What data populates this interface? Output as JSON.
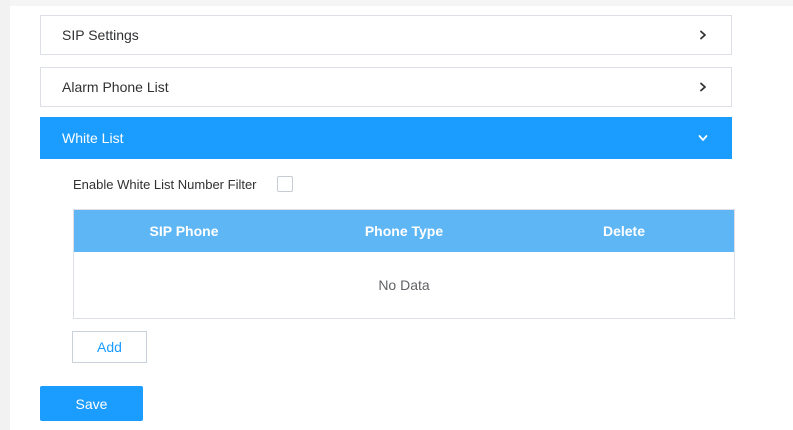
{
  "panels": {
    "sip_settings": {
      "title": "SIP Settings",
      "icon": "chevron-right-icon"
    },
    "alarm_phone_list": {
      "title": "Alarm Phone List",
      "icon": "chevron-right-icon"
    },
    "white_list": {
      "title": "White List",
      "icon": "chevron-down-icon",
      "expanded": true
    }
  },
  "white_list": {
    "filter_label": "Enable White List Number Filter",
    "filter_checked": false,
    "table": {
      "columns": [
        "SIP Phone",
        "Phone Type",
        "Delete"
      ],
      "rows": [],
      "empty_text": "No Data"
    },
    "add_label": "Add"
  },
  "actions": {
    "save_label": "Save"
  },
  "colors": {
    "accent": "#1b9cff",
    "table_header": "#5eb6f5",
    "border": "#dcdfe6",
    "text": "#303133"
  }
}
